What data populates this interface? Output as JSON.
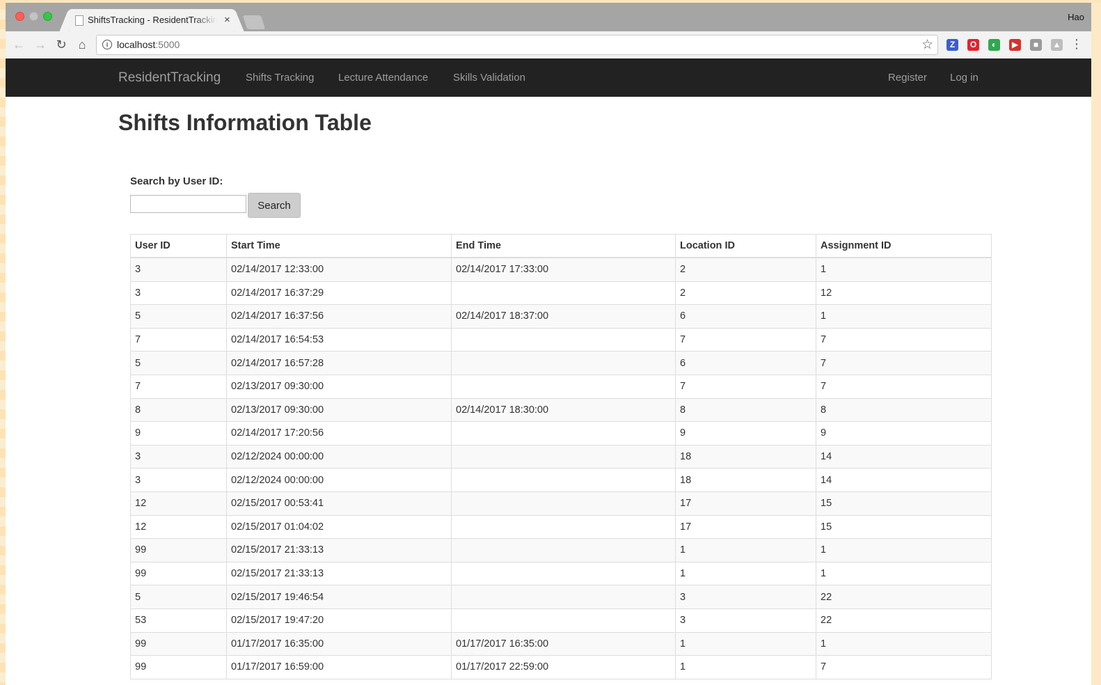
{
  "browser": {
    "tab_title": "ShiftsTracking - ResidentTracking",
    "tab_close": "×",
    "user_name": "Hao",
    "url_host": "localhost",
    "url_port": ":5000",
    "back_glyph": "←",
    "forward_glyph": "→",
    "reload_glyph": "↻",
    "home_glyph": "⌂",
    "star_glyph": "☆",
    "menu_glyph": "⋮",
    "extensions": [
      {
        "name": "zotero-extension-icon",
        "glyph": "Z",
        "color": "#3a5fcd"
      },
      {
        "name": "opera-extension-icon",
        "glyph": "O",
        "color": "#e8212b"
      },
      {
        "name": "color-extension-icon",
        "glyph": "◐",
        "color": "#2fa84f"
      },
      {
        "name": "youtube-extension-icon",
        "glyph": "▶",
        "color": "#d9302c"
      },
      {
        "name": "gray-extension-icon",
        "glyph": "■",
        "color": "#9a9a9a"
      },
      {
        "name": "drive-extension-icon",
        "glyph": "▲",
        "color": "#bdbdbd"
      }
    ]
  },
  "navbar": {
    "brand": "ResidentTracking",
    "links": [
      "Shifts Tracking",
      "Lecture Attendance",
      "Skills Validation"
    ],
    "register": "Register",
    "login": "Log in"
  },
  "page": {
    "title": "Shifts Information Table",
    "search_label": "Search by User ID:",
    "search_value": "",
    "search_button": "Search"
  },
  "table": {
    "headers": [
      "User ID",
      "Start Time",
      "End Time",
      "Location ID",
      "Assignment ID"
    ],
    "rows": [
      [
        "3",
        "02/14/2017 12:33:00",
        "02/14/2017 17:33:00",
        "2",
        "1"
      ],
      [
        "3",
        "02/14/2017 16:37:29",
        "",
        "2",
        "12"
      ],
      [
        "5",
        "02/14/2017 16:37:56",
        "02/14/2017 18:37:00",
        "6",
        "1"
      ],
      [
        "7",
        "02/14/2017 16:54:53",
        "",
        "7",
        "7"
      ],
      [
        "5",
        "02/14/2017 16:57:28",
        "",
        "6",
        "7"
      ],
      [
        "7",
        "02/13/2017 09:30:00",
        "",
        "7",
        "7"
      ],
      [
        "8",
        "02/13/2017 09:30:00",
        "02/14/2017 18:30:00",
        "8",
        "8"
      ],
      [
        "9",
        "02/14/2017 17:20:56",
        "",
        "9",
        "9"
      ],
      [
        "3",
        "02/12/2024 00:00:00",
        "",
        "18",
        "14"
      ],
      [
        "3",
        "02/12/2024 00:00:00",
        "",
        "18",
        "14"
      ],
      [
        "12",
        "02/15/2017 00:53:41",
        "",
        "17",
        "15"
      ],
      [
        "12",
        "02/15/2017 01:04:02",
        "",
        "17",
        "15"
      ],
      [
        "99",
        "02/15/2017 21:33:13",
        "",
        "1",
        "1"
      ],
      [
        "99",
        "02/15/2017 21:33:13",
        "",
        "1",
        "1"
      ],
      [
        "5",
        "02/15/2017 19:46:54",
        "",
        "3",
        "22"
      ],
      [
        "53",
        "02/15/2017 19:47:20",
        "",
        "3",
        "22"
      ],
      [
        "99",
        "01/17/2017 16:35:00",
        "01/17/2017 16:35:00",
        "1",
        "1"
      ],
      [
        "99",
        "01/17/2017 16:59:00",
        "01/17/2017 22:59:00",
        "1",
        "7"
      ]
    ]
  }
}
